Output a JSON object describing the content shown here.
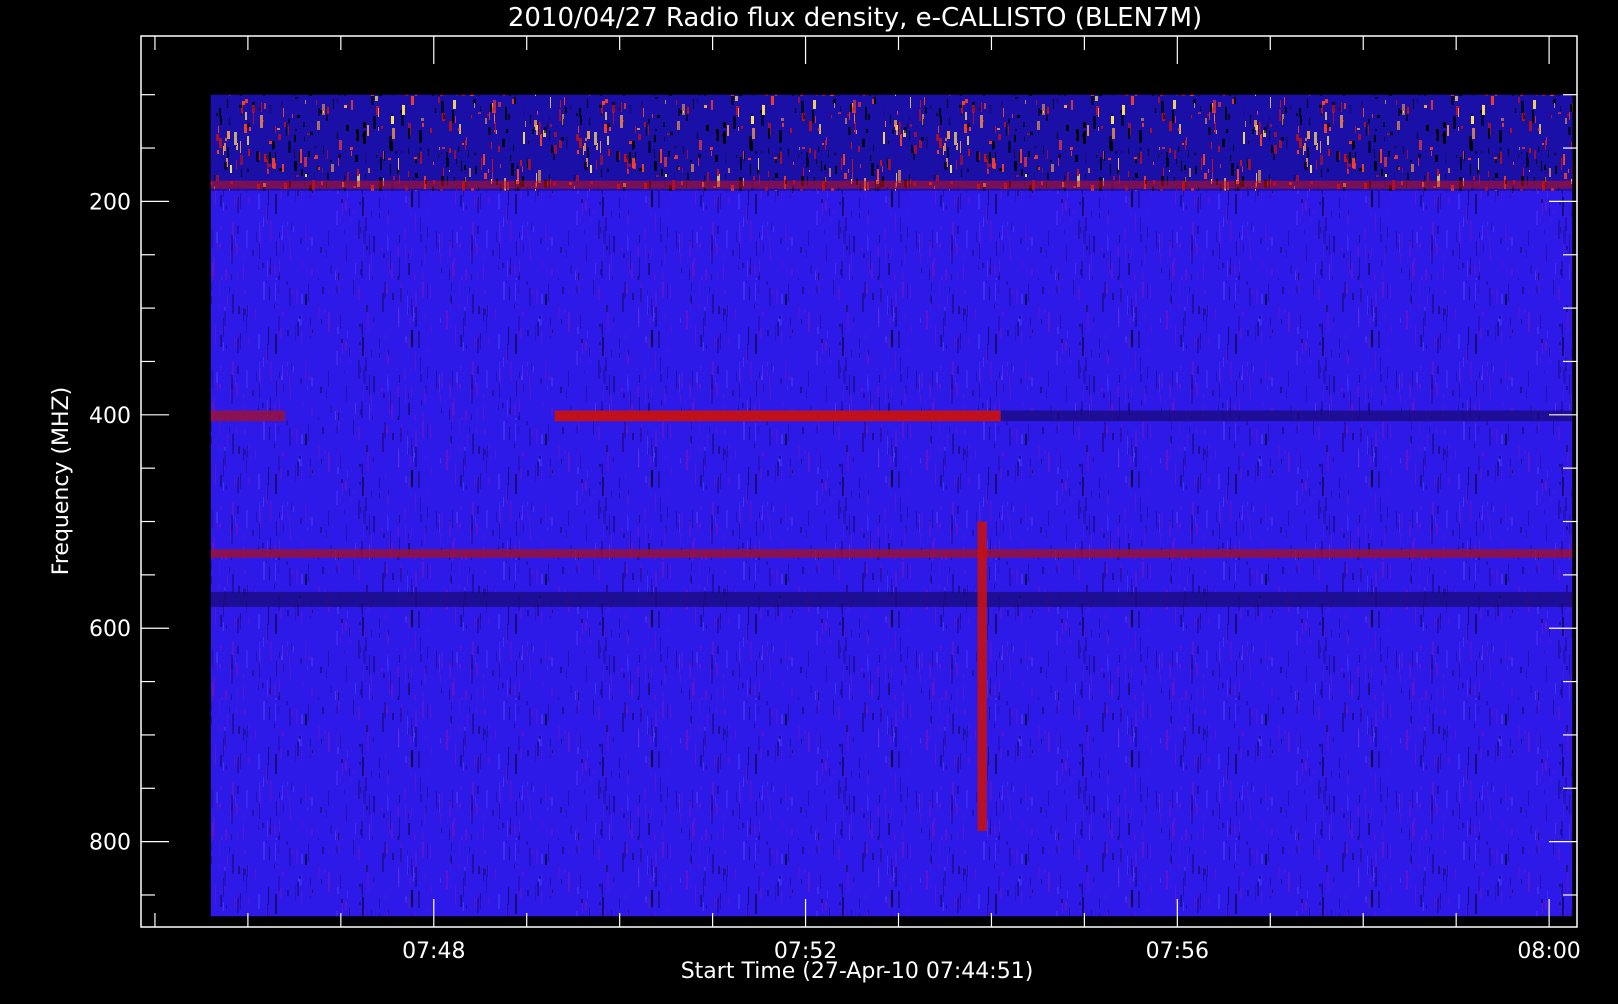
{
  "chart_data": {
    "type": "heatmap",
    "title": "2010/04/27  Radio flux density, e-CALLISTO (BLEN7M)",
    "xlabel": "Start Time (27-Apr-10 07:44:51)",
    "ylabel": "Frequency (MHZ)",
    "x_unit": "minutes",
    "x_ticks": [
      {
        "value": 48,
        "label": "07:48"
      },
      {
        "value": 52,
        "label": "07:52"
      },
      {
        "value": 56,
        "label": "07:56"
      },
      {
        "value": 60,
        "label": "08:00"
      }
    ],
    "y_ticks": [
      {
        "value": 200,
        "label": "200"
      },
      {
        "value": 400,
        "label": "400"
      },
      {
        "value": 600,
        "label": "600"
      },
      {
        "value": 800,
        "label": "800"
      }
    ],
    "x_range": [
      44.85,
      60.3
    ],
    "y_range": [
      880,
      45
    ],
    "data_extent": {
      "x": [
        45.6,
        60.25
      ],
      "y": [
        870,
        100
      ]
    },
    "colormap": [
      "#000000",
      "#1a0a80",
      "#2a1ae6",
      "#6a14c8",
      "#c81010",
      "#ff4020",
      "#ffa040",
      "#ffe060"
    ],
    "background_color": "#2e1ae8",
    "features": [
      {
        "name": "interference band",
        "freq_range": [
          100,
          190
        ],
        "time_range": [
          45.6,
          60.25
        ],
        "intensity": "high"
      },
      {
        "name": "emission band",
        "freq_range": [
          396,
          406
        ],
        "time_range": [
          45.6,
          46.4
        ],
        "intensity": "medium"
      },
      {
        "name": "emission band",
        "freq_range": [
          396,
          406
        ],
        "time_range": [
          49.3,
          54.1
        ],
        "intensity": "high"
      },
      {
        "name": "emission band",
        "freq_range": [
          396,
          406
        ],
        "time_range": [
          54.1,
          60.25
        ],
        "intensity": "low"
      },
      {
        "name": "emission band",
        "freq_range": [
          526,
          534
        ],
        "time_range": [
          45.6,
          60.25
        ],
        "intensity": "medium"
      },
      {
        "name": "emission band",
        "freq_range": [
          566,
          580
        ],
        "time_range": [
          45.6,
          60.25
        ],
        "intensity": "low"
      },
      {
        "name": "burst",
        "freq_range": [
          500,
          790
        ],
        "time_range": [
          53.85,
          53.95
        ],
        "intensity": "high"
      }
    ]
  }
}
